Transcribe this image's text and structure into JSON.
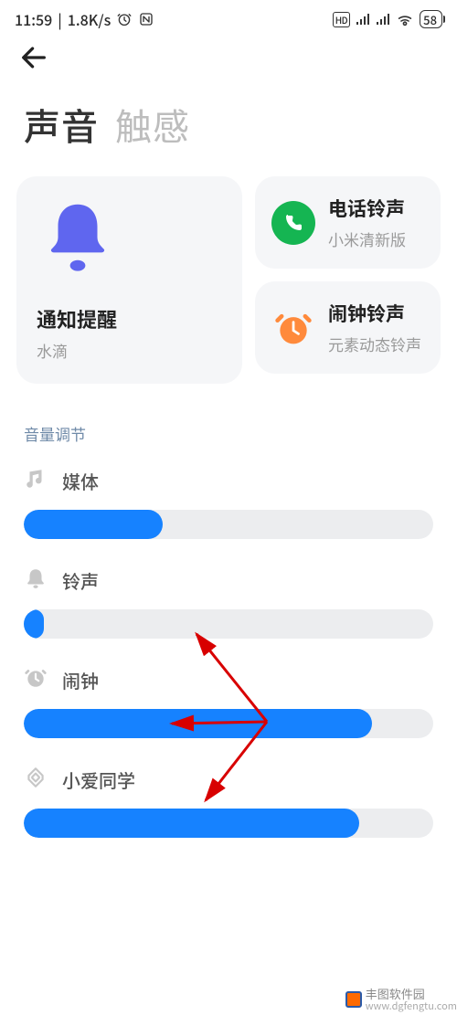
{
  "statusbar": {
    "time": "11:59",
    "net_speed": "1.8K/s",
    "battery": "58"
  },
  "tabs": {
    "active": "声音",
    "inactive": "触感"
  },
  "card_notify": {
    "title": "通知提醒",
    "sub": "水滴"
  },
  "card_call": {
    "title": "电话铃声",
    "sub": "小米清新版"
  },
  "card_alarm_ring": {
    "title": "闹钟铃声",
    "sub": "元素动态铃声"
  },
  "section": {
    "volume": "音量调节"
  },
  "volumes": {
    "media": {
      "label": "媒体",
      "pct": 34
    },
    "ring": {
      "label": "铃声",
      "pct": 5
    },
    "alarm": {
      "label": "闹钟",
      "pct": 85
    },
    "xiaoai": {
      "label": "小爱同学",
      "pct": 82
    }
  },
  "watermark": {
    "line1": "丰图软件园",
    "line2": "www.dgfengtu.com"
  }
}
